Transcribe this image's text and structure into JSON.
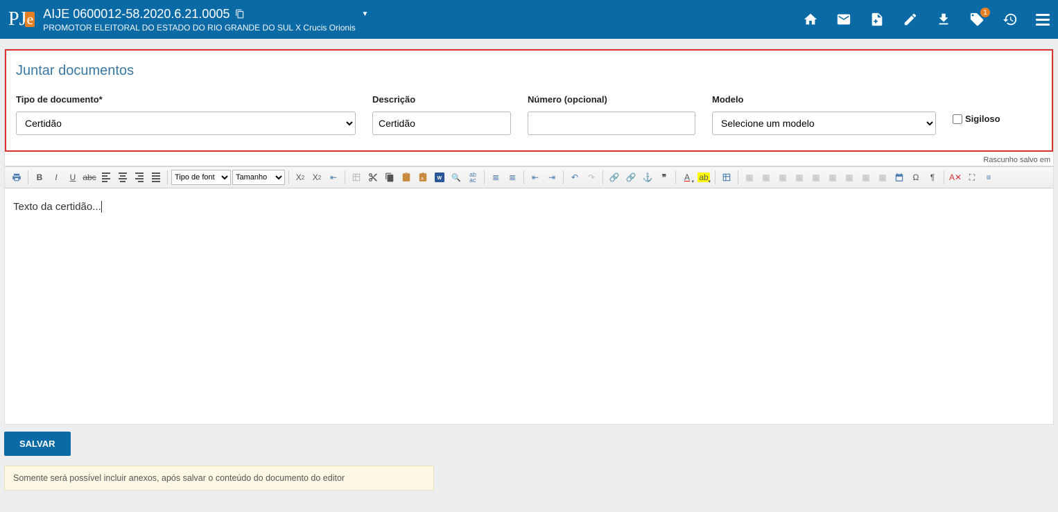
{
  "header": {
    "logo_text": "PJe",
    "case_title": "AIJE 0600012-58.2020.6.21.0005",
    "case_subtitle": "PROMOTOR ELEITORAL DO ESTADO DO RIO GRANDE DO SUL X Crucis Orionis",
    "badge_count": "1"
  },
  "panel": {
    "title": "Juntar documentos",
    "draft_status": "Rascunho salvo em"
  },
  "form": {
    "tipo_label": "Tipo de documento*",
    "tipo_value": "Certidão",
    "desc_label": "Descrição",
    "desc_value": "Certidão",
    "num_label": "Número (opcional)",
    "num_value": "",
    "modelo_label": "Modelo",
    "modelo_value": "Selecione um modelo",
    "sigiloso_label": "Sigiloso"
  },
  "toolbar": {
    "font_label": "Tipo de font",
    "size_label": "Tamanho"
  },
  "editor": {
    "content": "Texto da certidão..."
  },
  "actions": {
    "save_label": "SALVAR"
  },
  "notice": {
    "text": "Somente será possível incluir anexos, após salvar o conteúdo do documento do editor"
  }
}
